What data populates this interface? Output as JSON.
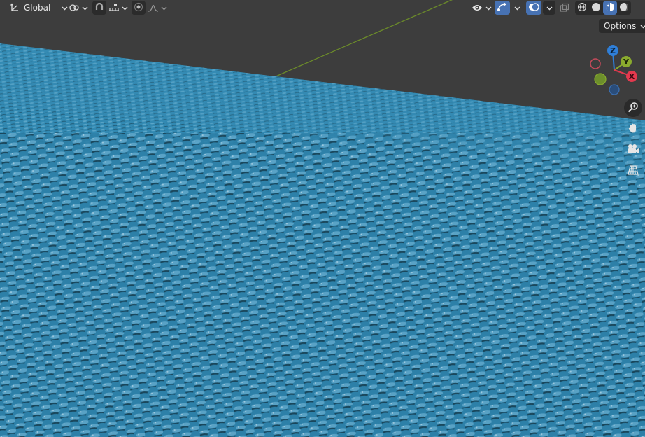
{
  "header": {
    "transform_orientation": {
      "label": "Global",
      "icon": "orientation-axes-icon"
    },
    "pivot_point": {
      "icon": "pivot-point-icon"
    },
    "snapping": {
      "icon": "snap-magnet-icon",
      "target_icon": "snap-increment-icon"
    },
    "proportional_editing": {
      "icon": "proportional-edit-icon",
      "falloff_icon": "falloff-curve-icon"
    },
    "visibility": {
      "icon": "eye-icon"
    },
    "gizmos": {
      "icon": "gizmo-icon",
      "active": true
    },
    "overlays": {
      "icon": "overlays-icon",
      "active": true
    },
    "xray": {
      "icon": "xray-icon"
    },
    "shading_modes": [
      {
        "name": "wireframe",
        "icon": "wireframe-shading-icon",
        "active": false
      },
      {
        "name": "solid",
        "icon": "solid-shading-icon",
        "active": false
      },
      {
        "name": "material-preview",
        "icon": "material-preview-shading-icon",
        "active": true
      },
      {
        "name": "rendered",
        "icon": "rendered-shading-icon",
        "active": false
      }
    ]
  },
  "options": {
    "label": "Options"
  },
  "navigation_gizmo": {
    "axes": [
      {
        "label": "Z",
        "color": "#2f7fd8"
      },
      {
        "label": "Y",
        "color": "#8aab2e"
      },
      {
        "label": "X",
        "color": "#e2394e"
      }
    ]
  },
  "navigation_buttons": [
    {
      "name": "zoom",
      "icon": "zoom-icon"
    },
    {
      "name": "pan",
      "icon": "hand-icon"
    },
    {
      "name": "camera",
      "icon": "camera-icon"
    },
    {
      "name": "perspective",
      "icon": "perspective-grid-icon"
    }
  ],
  "scene": {
    "background_color": "#3d3d3d",
    "floor_color": "#2c7ea4",
    "y_axis_line_color": "#6b8a2a"
  }
}
